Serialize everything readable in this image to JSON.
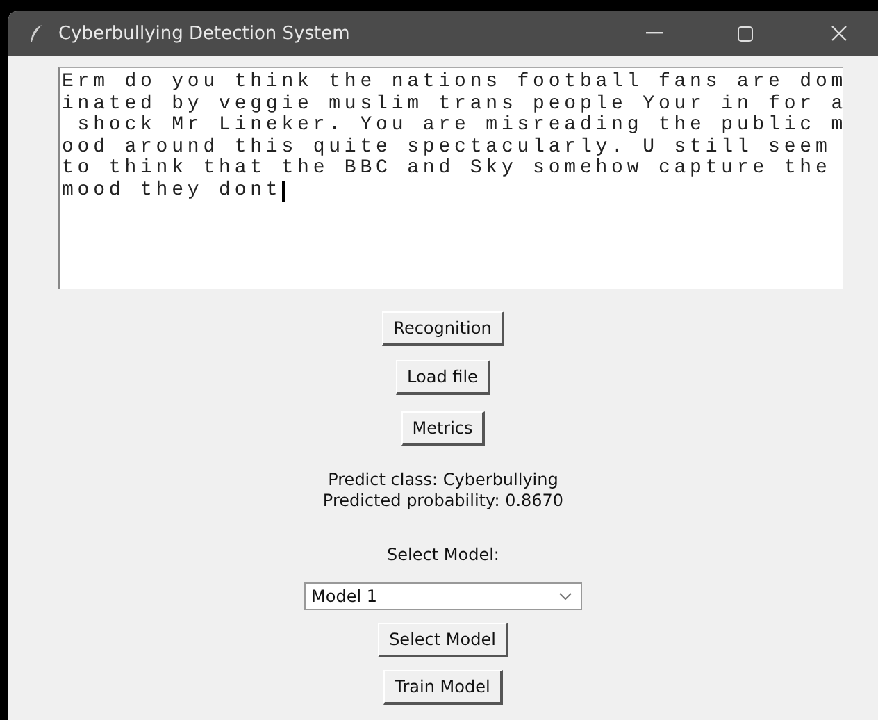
{
  "window": {
    "title": "Cyberbullying Detection System"
  },
  "text_area": {
    "lines": [
      "Erm do you think the nations football fans are dom",
      "inated by veggie muslim trans people Your in for a",
      " shock Mr Lineker. You are misreading the public m",
      "ood around this quite spectacularly. U still seem",
      "to think that the BBC and Sky somehow capture the",
      "mood they dont"
    ]
  },
  "actions": [
    "Recognition",
    "Load file",
    "Metrics"
  ],
  "result": [
    "Predict class: Cyberbullying",
    "Predicted probability: 0.8670"
  ],
  "model_label": "Select Model:",
  "model_select": {
    "value": "Model 1"
  },
  "model_buttons": [
    "Select Model",
    "Train Model"
  ]
}
